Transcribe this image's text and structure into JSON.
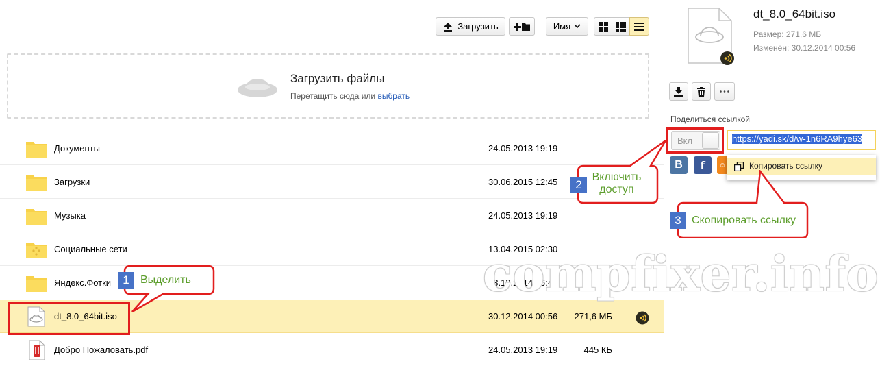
{
  "toolbar": {
    "upload_label": "Загрузить",
    "sort_label": "Имя"
  },
  "dropzone": {
    "title": "Загрузить файлы",
    "subtitle": "Перетащить сюда или ",
    "choose_link": "выбрать"
  },
  "files": [
    {
      "name": "Документы",
      "date": "24.05.2013 19:19",
      "size": "",
      "type": "folder"
    },
    {
      "name": "Загрузки",
      "date": "30.06.2015 12:45",
      "size": "",
      "type": "folder"
    },
    {
      "name": "Музыка",
      "date": "24.05.2013 19:19",
      "size": "",
      "type": "folder"
    },
    {
      "name": "Социальные сети",
      "date": "13.04.2015 02:30",
      "size": "",
      "type": "folder-social"
    },
    {
      "name": "Яндекс.Фотки",
      "date": "03.12.2014 16:43",
      "size": "",
      "type": "folder"
    },
    {
      "name": "dt_8.0_64bit.iso",
      "date": "30.12.2014 00:56",
      "size": "271,6 МБ",
      "type": "iso",
      "selected": true,
      "shared": true
    },
    {
      "name": "Добро Пожаловать.pdf",
      "date": "24.05.2013 19:19",
      "size": "445 КБ",
      "type": "pdf"
    }
  ],
  "sidebar": {
    "file_name": "dt_8.0_64bit.iso",
    "size_line": "Размер: 271,6 МБ",
    "modified_line": "Изменён: 30.12.2014 00:56",
    "share_label": "Поделиться ссылкой",
    "toggle_label": "Вкл",
    "share_url": "https://yadi.sk/d/w-1n6RA9hye63",
    "copy_link_label": "Копировать ссылку",
    "social": [
      {
        "name": "vk",
        "glyph": "В",
        "color": "#4c75a3"
      },
      {
        "name": "facebook",
        "glyph": "f",
        "color": "#3b5998"
      },
      {
        "name": "odnoklassniki",
        "glyph": "ok",
        "color": "#f2881c"
      }
    ]
  },
  "annotations": {
    "step1_num": "1",
    "step1_text": "Выделить",
    "step2_num": "2",
    "step2_line1": "Включить",
    "step2_line2": "доступ",
    "step3_num": "3",
    "step3_text": "Скопировать ссылку",
    "watermark": "compfixer.info"
  },
  "colors": {
    "selection": "#fdf0b7",
    "annotation_red": "#e21e1e",
    "annotation_green": "#5d9e2d",
    "badge_blue": "#4772c7",
    "link_blue": "#1f57b6"
  }
}
